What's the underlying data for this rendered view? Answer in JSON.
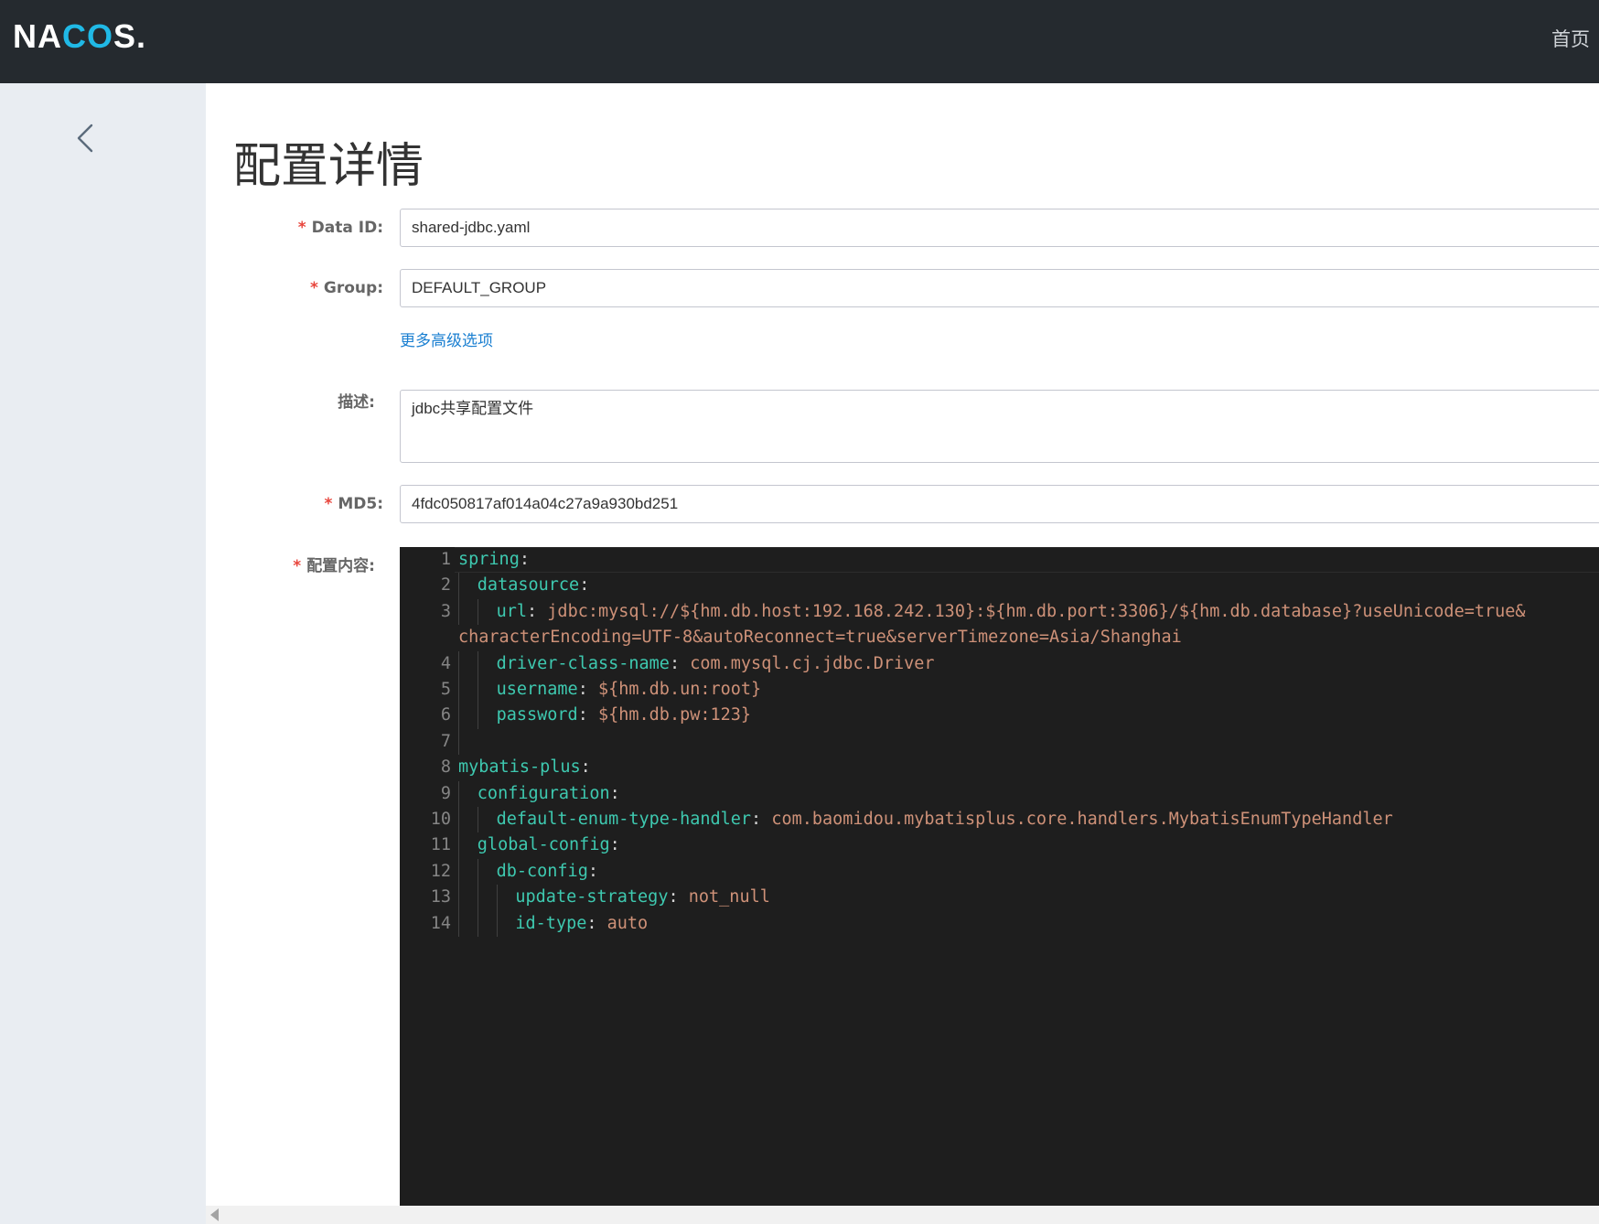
{
  "header": {
    "logo_main": "NA",
    "logo_accent": "CO",
    "logo_tail": "S.",
    "home_label": "首页"
  },
  "page": {
    "title": "配置详情"
  },
  "form": {
    "data_id_label": "Data ID:",
    "data_id_value": "shared-jdbc.yaml",
    "group_label": "Group:",
    "group_value": "DEFAULT_GROUP",
    "advanced_link": "更多高级选项",
    "desc_label": "描述:",
    "desc_value": "jdbc共享配置文件",
    "md5_label": "MD5:",
    "md5_value": "4fdc050817af014a04c27a9a930bd251",
    "content_label": "配置内容:",
    "required_mark": "*"
  },
  "editor": {
    "lines": [
      {
        "num": "1",
        "key": "spring",
        "sep": ":",
        "val": ""
      },
      {
        "num": "2",
        "key": "datasource",
        "sep": ":",
        "val": ""
      },
      {
        "num": "3",
        "key": "url",
        "sep": ": ",
        "val": "jdbc:mysql://${hm.db.host:192.168.242.130}:${hm.db.port:3306}/${hm.db.database}?useUnicode=true&"
      },
      {
        "num": "",
        "key": "",
        "sep": "",
        "val": "characterEncoding=UTF-8&autoReconnect=true&serverTimezone=Asia/Shanghai"
      },
      {
        "num": "4",
        "key": "driver-class-name",
        "sep": ": ",
        "val": "com.mysql.cj.jdbc.Driver"
      },
      {
        "num": "5",
        "key": "username",
        "sep": ": ",
        "val": "${hm.db.un:root}"
      },
      {
        "num": "6",
        "key": "password",
        "sep": ": ",
        "val": "${hm.db.pw:123}"
      },
      {
        "num": "7",
        "key": "",
        "sep": "",
        "val": ""
      },
      {
        "num": "8",
        "key": "mybatis-plus",
        "sep": ":",
        "val": ""
      },
      {
        "num": "9",
        "key": "configuration",
        "sep": ":",
        "val": ""
      },
      {
        "num": "10",
        "key": "default-enum-type-handler",
        "sep": ": ",
        "val": "com.baomidou.mybatisplus.core.handlers.MybatisEnumTypeHandler"
      },
      {
        "num": "11",
        "key": "global-config",
        "sep": ":",
        "val": ""
      },
      {
        "num": "12",
        "key": "db-config",
        "sep": ":",
        "val": ""
      },
      {
        "num": "13",
        "key": "update-strategy",
        "sep": ": ",
        "val": "not_null"
      },
      {
        "num": "14",
        "key": "id-type",
        "sep": ": ",
        "val": "auto"
      }
    ]
  },
  "colors": {
    "topbar": "#252a2f",
    "logo_accent": "#20b9e6",
    "side": "#e9edf2",
    "link": "#1a7fd1",
    "required": "#e8453c",
    "editor_bg": "#1e1e1e",
    "yaml_key": "#3ec9b0",
    "yaml_value": "#ce9178"
  }
}
